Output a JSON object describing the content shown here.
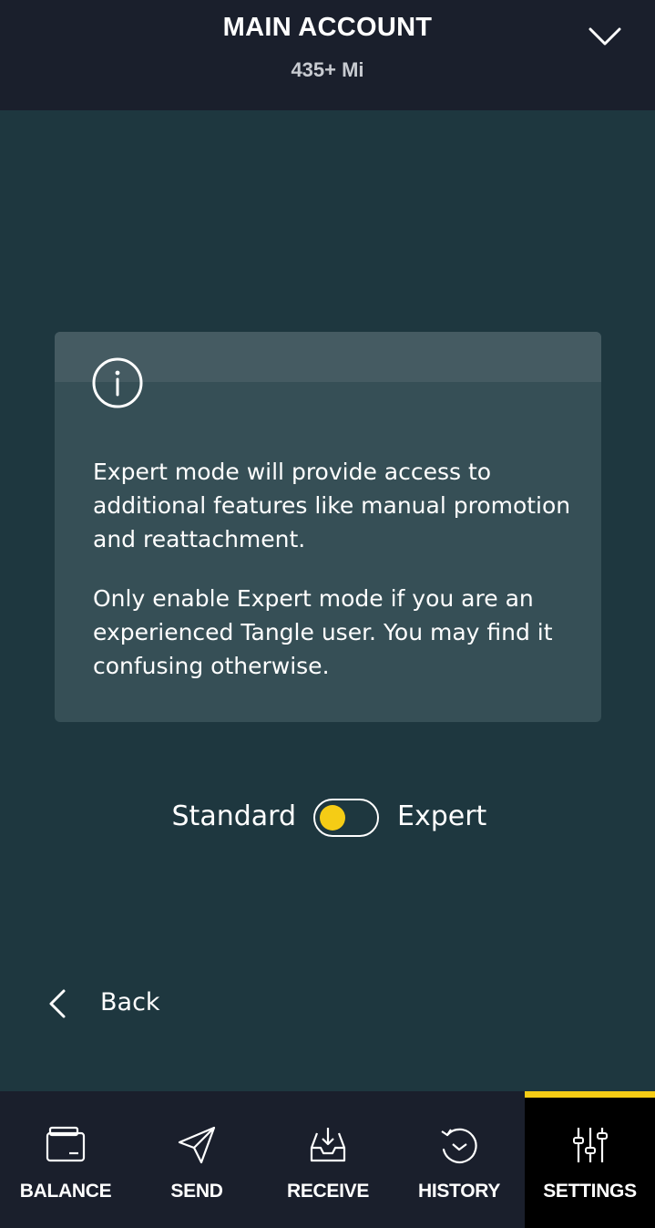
{
  "header": {
    "account_name": "MAIN ACCOUNT",
    "balance": "435+ Mi",
    "dropdown_icon": "chevron-down-icon"
  },
  "info_card": {
    "icon": "info-icon",
    "paragraph_1": "Expert mode will provide access to additional features like manual promotion and reattachment.",
    "paragraph_2": "Only enable Expert mode if you are an experienced Tangle user. You may find it confusing otherwise."
  },
  "mode_toggle": {
    "left_label": "Standard",
    "right_label": "Expert",
    "state": "off",
    "knob_color": "#f5cc15"
  },
  "back": {
    "label": "Back",
    "icon": "chevron-left-icon"
  },
  "bottom_nav": {
    "items": [
      {
        "label": "BALANCE",
        "icon": "wallet-icon",
        "active": false
      },
      {
        "label": "SEND",
        "icon": "paper-plane-icon",
        "active": false
      },
      {
        "label": "RECEIVE",
        "icon": "inbox-download-icon",
        "active": false
      },
      {
        "label": "HISTORY",
        "icon": "history-clock-icon",
        "active": false
      },
      {
        "label": "SETTINGS",
        "icon": "sliders-icon",
        "active": true
      }
    ],
    "accent_color": "#f5cc15"
  },
  "colors": {
    "background": "#1e373f",
    "header_bg": "#1a1f2c",
    "card_bg": "#364f56",
    "accent": "#f5cc15"
  }
}
